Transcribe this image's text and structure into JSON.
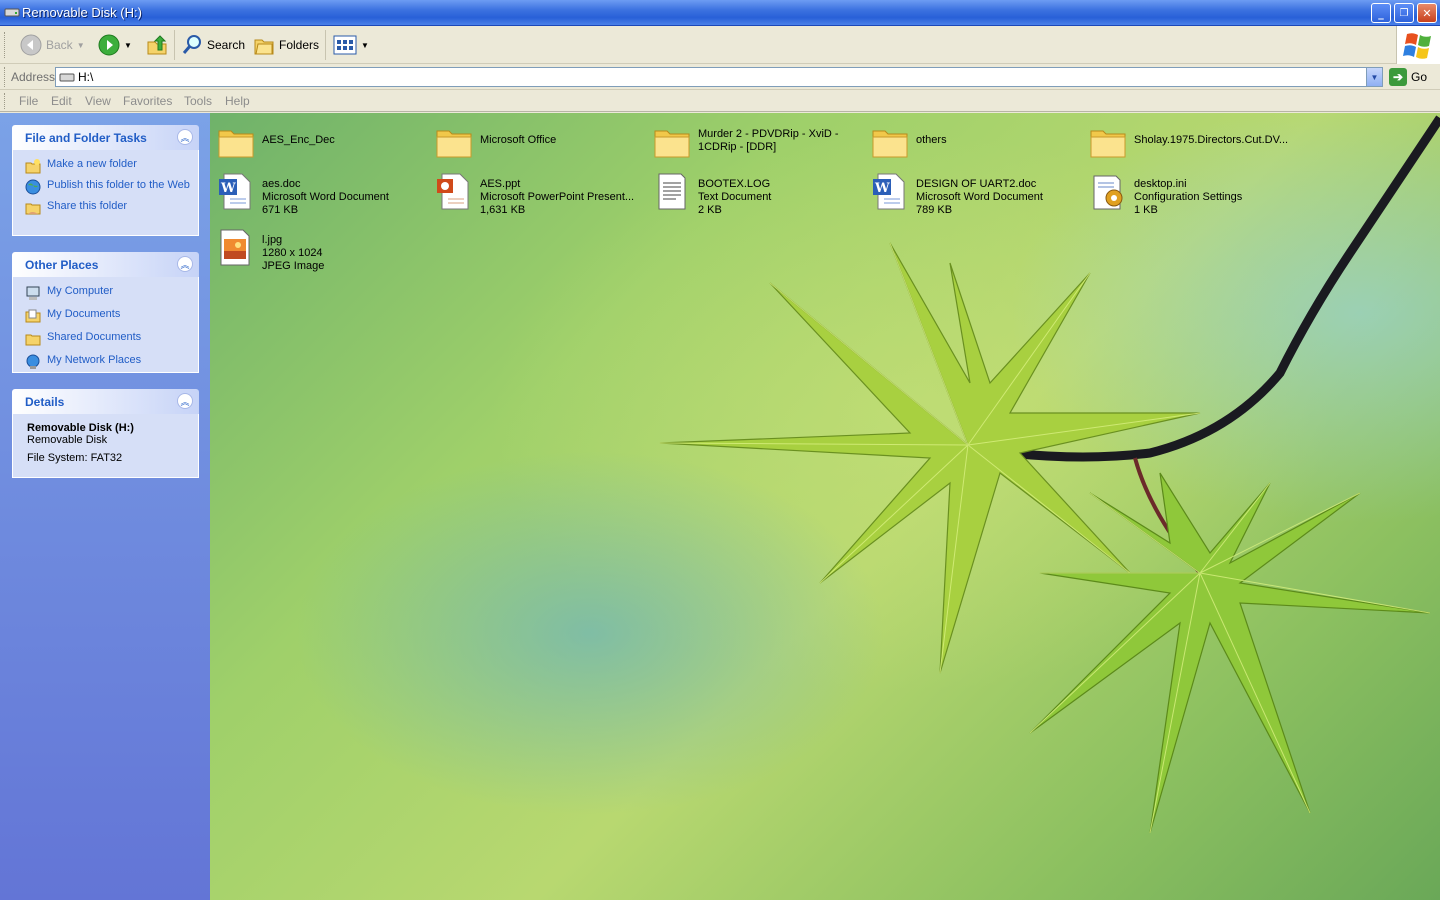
{
  "window": {
    "title": "Removable Disk (H:)",
    "icon": "drive-icon"
  },
  "controls": {
    "minimize": "_",
    "restore": "❐",
    "close": "✕"
  },
  "toolbar": {
    "back_label": "Back",
    "search_label": "Search",
    "folders_label": "Folders"
  },
  "address": {
    "label": "Address",
    "value": "H:\\",
    "go_label": "Go"
  },
  "menu": [
    "File",
    "Edit",
    "View",
    "Favorites",
    "Tools",
    "Help"
  ],
  "tasks": {
    "title": "File and Folder Tasks",
    "items": [
      {
        "label": "Make a new folder",
        "icon": "new-folder-icon"
      },
      {
        "label": "Publish this folder to the Web",
        "icon": "publish-web-icon"
      },
      {
        "label": "Share this folder",
        "icon": "share-folder-icon"
      }
    ]
  },
  "places": {
    "title": "Other Places",
    "items": [
      {
        "label": "My Computer",
        "icon": "my-computer-icon"
      },
      {
        "label": "My Documents",
        "icon": "my-documents-icon"
      },
      {
        "label": "Shared Documents",
        "icon": "shared-documents-icon"
      },
      {
        "label": "My Network Places",
        "icon": "network-places-icon"
      }
    ]
  },
  "details": {
    "title": "Details",
    "name": "Removable Disk (H:)",
    "type": "Removable Disk",
    "filesystem": "File System: FAT32"
  },
  "files": [
    {
      "name": "AES_Enc_Dec",
      "kind": "folder"
    },
    {
      "name": "Microsoft Office",
      "kind": "folder"
    },
    {
      "name": "Murder 2 - PDVDRip - XviD -",
      "name2": "1CDRip - [DDR]",
      "kind": "folder"
    },
    {
      "name": "others",
      "kind": "folder"
    },
    {
      "name": "Sholay.1975.Directors.Cut.DV...",
      "kind": "folder"
    },
    {
      "name": "aes.doc",
      "type": "Microsoft Word Document",
      "size": "671 KB",
      "kind": "word"
    },
    {
      "name": "AES.ppt",
      "type": "Microsoft PowerPoint Present...",
      "size": "1,631 KB",
      "kind": "ppt"
    },
    {
      "name": "BOOTEX.LOG",
      "type": "Text Document",
      "size": "2 KB",
      "kind": "text"
    },
    {
      "name": "DESIGN OF UART2.doc",
      "type": "Microsoft Word Document",
      "size": "789 KB",
      "kind": "word"
    },
    {
      "name": "desktop.ini",
      "type": "Configuration Settings",
      "size": "1 KB",
      "kind": "ini"
    },
    {
      "name": "l.jpg",
      "type": "1280 x 1024",
      "size": "JPEG Image",
      "kind": "jpg"
    }
  ]
}
